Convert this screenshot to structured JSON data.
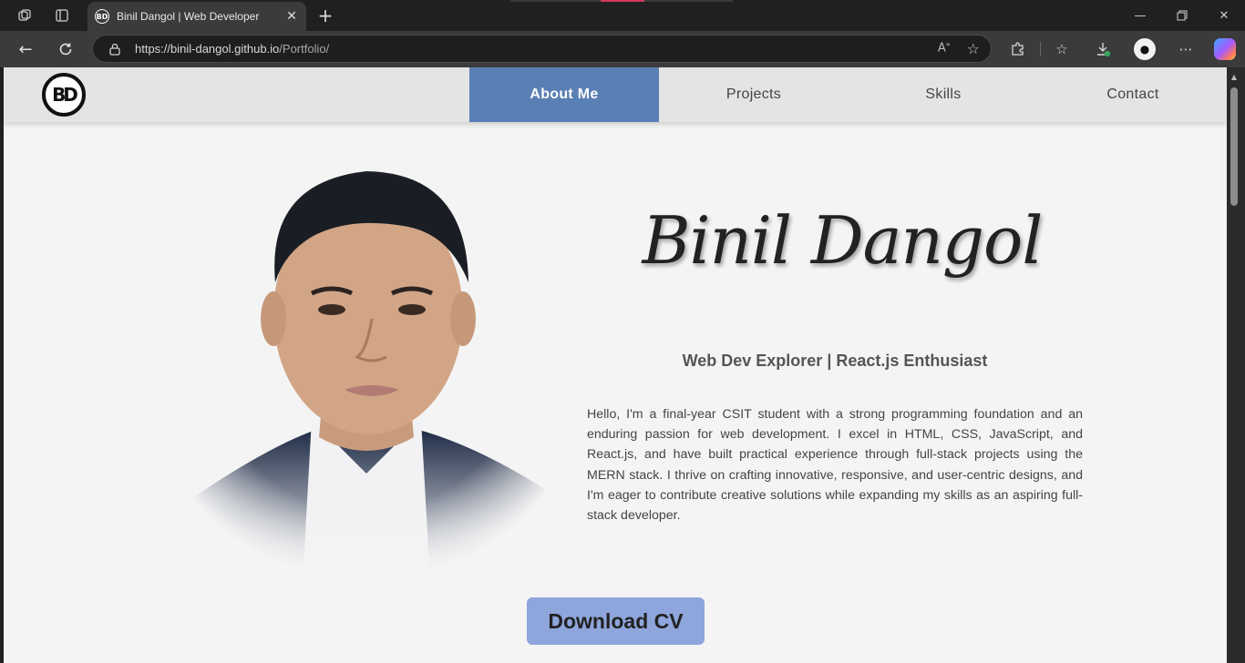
{
  "browser": {
    "tab": {
      "title": "Binil Dangol | Web Developer",
      "favicon_text": "BD"
    },
    "url": {
      "origin": "https://binil-dangol.github.io",
      "path": "/Portfolio/"
    },
    "icons": [
      "workspaces-icon",
      "tab-actions-icon",
      "close-icon",
      "new-tab-icon",
      "minimize-icon",
      "restore-icon",
      "window-close-icon",
      "back-icon",
      "refresh-icon",
      "lock-icon",
      "read-aloud-icon",
      "favorite-star-icon",
      "extensions-icon",
      "favorites-icon",
      "downloads-icon",
      "profile-avatar",
      "more-icon",
      "copilot-icon"
    ]
  },
  "site": {
    "logo_text": "BD",
    "nav": [
      {
        "label": "About Me",
        "active": true
      },
      {
        "label": "Projects",
        "active": false
      },
      {
        "label": "Skills",
        "active": false
      },
      {
        "label": "Contact",
        "active": false
      }
    ],
    "hero": {
      "name": "Binil Dangol",
      "subtitle": "Web Dev Explorer | React.js Enthusiast",
      "bio": "Hello, I'm a final-year CSIT student with a strong programming foundation and an enduring passion for web development. I excel in HTML, CSS, JavaScript, and React.js, and have built practical experience through full-stack projects using the MERN stack. I thrive on crafting innovative, responsive, and user-centric designs, and I'm eager to contribute creative solutions while expanding my skills as an aspiring full-stack developer.",
      "cta": "Download CV"
    },
    "colors": {
      "nav_active": "#5a7fb4",
      "cta": "#8ea6dc",
      "page_bg": "#f4f4f4"
    }
  }
}
